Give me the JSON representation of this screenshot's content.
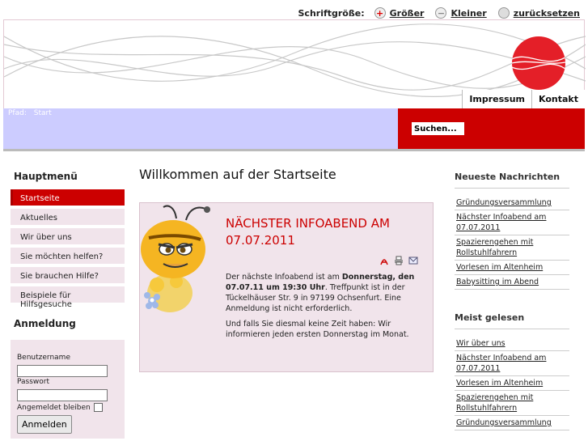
{
  "fontsize": {
    "label": "Schriftgröße:",
    "bigger": "Größer",
    "smaller": "Kleiner",
    "reset": "zurücksetzen"
  },
  "topnav": [
    "Impressum",
    "Kontakt"
  ],
  "path": {
    "label": "Pfad:",
    "current": "Start"
  },
  "search": {
    "value": "Suchen..."
  },
  "sidebar": {
    "title": "Hauptmenü",
    "items": [
      {
        "label": "Startseite",
        "active": true
      },
      {
        "label": "Aktuelles"
      },
      {
        "label": "Wir über uns"
      },
      {
        "label": "Sie möchten helfen?"
      },
      {
        "label": "Sie brauchen Hilfe?"
      },
      {
        "label": "Beispiele für Hilfsgesuche"
      }
    ]
  },
  "login": {
    "title": "Anmeldung",
    "username_label": "Benutzername",
    "password_label": "Passwort",
    "remember_label": "Angemeldet bleiben",
    "button": "Anmelden"
  },
  "main": {
    "title": "Willkommen auf der Startseite",
    "article": {
      "title": "Nächster Infoabend am 07.07.2011",
      "icons": [
        "pdf-icon",
        "print-icon",
        "email-icon"
      ],
      "p1_pre": "Der nächste Infoabend ist am ",
      "p1_bold": "Donnerstag, den 07.07.11 um 19:30 Uhr",
      "p1_post": ". Treffpunkt ist in der Tückelhäuser Str. 9 in 97199 Ochsenfurt. Eine Anmeldung ist nicht erforderlich.",
      "p2": "Und falls Sie diesmal keine Zeit haben: Wir informieren jeden ersten Donnerstag im Monat."
    }
  },
  "news": {
    "title": "Neueste Nachrichten",
    "items": [
      "Gründungsversammlung",
      "Nächster Infoabend am 07.07.2011",
      "Spazierengehen mit Rollstuhlfahrern",
      "Vorlesen im Altenheim",
      "Babysitting im Abend"
    ]
  },
  "popular": {
    "title": "Meist gelesen",
    "items": [
      "Wir über uns",
      "Nächster Infoabend am 07.07.2011",
      "Vorlesen im Altenheim",
      "Spazierengehen mit Rollstuhlfahrern",
      "Gründungsversammlung"
    ]
  },
  "colors": {
    "accent": "#cc0000",
    "band": "#ccccff",
    "panel": "#f1e4eb"
  }
}
